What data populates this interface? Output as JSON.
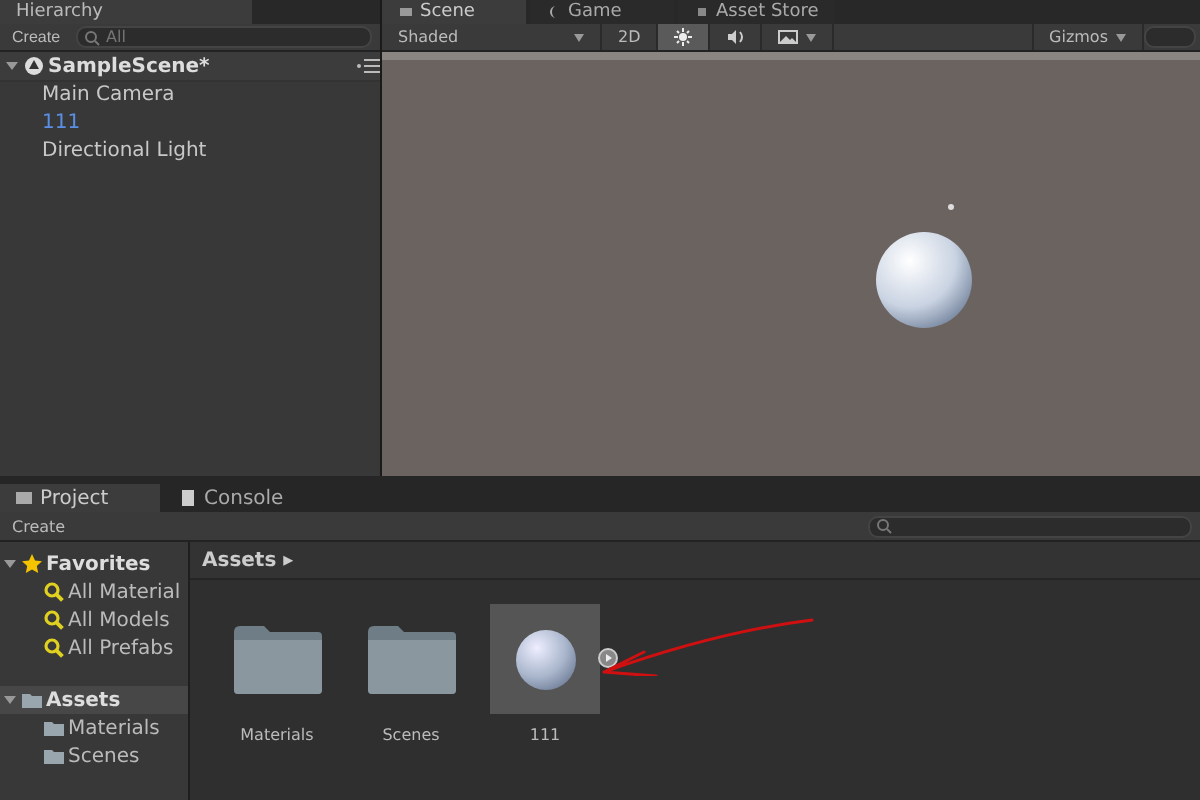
{
  "hierarchy": {
    "tab": {
      "label": "Hierarchy",
      "selected": true
    },
    "create": "Create",
    "search": {
      "placeholder": "All"
    },
    "scene": {
      "label": "SampleScene*",
      "expanded": true
    },
    "items": [
      {
        "label": "Main Camera",
        "selected": false
      },
      {
        "label": "111",
        "selected": true
      },
      {
        "label": "Directional Light",
        "selected": false
      }
    ]
  },
  "scene_view": {
    "tabs": [
      {
        "label": "Scene",
        "selected": true,
        "kind": "scene"
      },
      {
        "label": "Game",
        "selected": false,
        "kind": "game"
      },
      {
        "label": "Asset Store",
        "selected": false,
        "kind": "store"
      }
    ],
    "shading": "Shaded",
    "mode_2d": {
      "label": "2D",
      "on": false
    },
    "lighting": {
      "on": true
    },
    "audio": {
      "on": false
    },
    "effects": {
      "on": false
    },
    "gizmos": "Gizmos"
  },
  "project": {
    "tabs": [
      {
        "label": "Project",
        "selected": true,
        "kind": "project"
      },
      {
        "label": "Console",
        "selected": false,
        "kind": "console"
      }
    ],
    "create": "Create",
    "sidebar": [
      {
        "label": "Favorites",
        "kind": "favorites",
        "expanded": true,
        "children": [
          {
            "label": "All Material"
          },
          {
            "label": "All Models"
          },
          {
            "label": "All Prefabs"
          }
        ]
      },
      {
        "label": "Assets",
        "kind": "folder",
        "expanded": true,
        "selected": true,
        "children": [
          {
            "label": "Materials"
          },
          {
            "label": "Scenes"
          }
        ]
      }
    ],
    "breadcrumb": "Assets ▸",
    "assets": [
      {
        "label": "Materials",
        "kind": "folder",
        "selected": false
      },
      {
        "label": "Scenes",
        "kind": "folder",
        "selected": false
      },
      {
        "label": "111",
        "kind": "material",
        "selected": true
      }
    ]
  }
}
